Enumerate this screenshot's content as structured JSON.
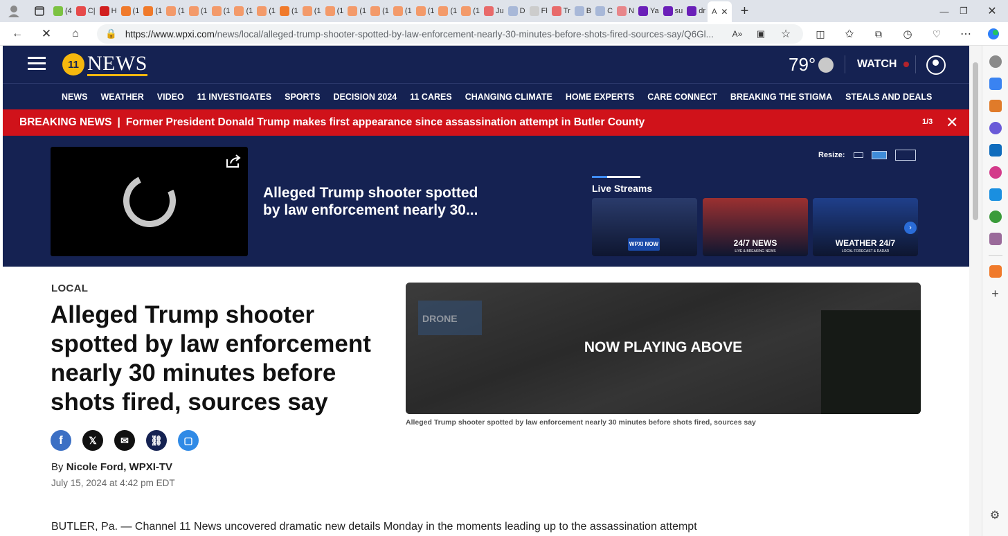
{
  "browser": {
    "tabs": [
      {
        "label": "(4",
        "color": "#7cc242"
      },
      {
        "label": "C|",
        "color": "#e64a4a"
      },
      {
        "label": "H",
        "color": "#d11f1f"
      },
      {
        "label": "(1",
        "color": "#f07a2b"
      },
      {
        "label": "(1",
        "color": "#f07a2b"
      },
      {
        "label": "(1",
        "color": "#f39a6a"
      },
      {
        "label": "(1",
        "color": "#f39a6a"
      },
      {
        "label": "(1",
        "color": "#f39a6a"
      },
      {
        "label": "(1",
        "color": "#f39a6a"
      },
      {
        "label": "(1",
        "color": "#f39a6a"
      },
      {
        "label": "(1",
        "color": "#f07a2b"
      },
      {
        "label": "(1",
        "color": "#f39a6a"
      },
      {
        "label": "(1",
        "color": "#f39a6a"
      },
      {
        "label": "(1",
        "color": "#f39a6a"
      },
      {
        "label": "(1",
        "color": "#f39a6a"
      },
      {
        "label": "(1",
        "color": "#f39a6a"
      },
      {
        "label": "(1",
        "color": "#f39a6a"
      },
      {
        "label": "(1",
        "color": "#f39a6a"
      },
      {
        "label": "(1",
        "color": "#f39a6a"
      },
      {
        "label": "Ju",
        "color": "#e86a6a"
      },
      {
        "label": "D",
        "color": "#a8b8d8"
      },
      {
        "label": "Fl",
        "color": "#cccccc"
      },
      {
        "label": "Tr",
        "color": "#e86a6a"
      },
      {
        "label": "B",
        "color": "#a8b8d8"
      },
      {
        "label": "C",
        "color": "#a8b8d8"
      },
      {
        "label": "N",
        "color": "#e8868a"
      },
      {
        "label": "Ya",
        "color": "#6a1fb8"
      },
      {
        "label": "su",
        "color": "#6a1fb8"
      },
      {
        "label": "dr",
        "color": "#6a1fb8"
      }
    ],
    "active_tab": {
      "label": "A",
      "close": "✕"
    },
    "new_tab": "+",
    "url_host": "https://www.wpxi.com",
    "url_path": "/news/local/alleged-trump-shooter-spotted-by-law-enforcement-nearly-30-minutes-before-shots-fired-sources-say/Q6Gl..."
  },
  "site": {
    "logo_number": "11",
    "logo_text": "NEWS",
    "temperature": "79°",
    "watch_label": "WATCH",
    "nav": [
      "NEWS",
      "WEATHER",
      "VIDEO",
      "11 INVESTIGATES",
      "SPORTS",
      "DECISION 2024",
      "11 CARES",
      "CHANGING CLIMATE",
      "HOME EXPERTS",
      "CARE CONNECT",
      "BREAKING THE STIGMA",
      "STEALS AND DEALS"
    ],
    "breaking": {
      "label": "BREAKING NEWS",
      "separator": "|",
      "text": "Former President Donald Trump makes first appearance since assassination attempt in Butler County",
      "count": "1/3",
      "close": "✕"
    }
  },
  "hero": {
    "title": "Alleged Trump shooter spotted by law enforcement nearly 30...",
    "resize_label": "Resize:",
    "live_streams_label": "Live Streams",
    "streams": [
      {
        "label": "",
        "badge": "WPXI NOW",
        "bg": "#2a3b6b"
      },
      {
        "label": "24/7 NEWS",
        "sub": "LIVE & BREAKING NEWS",
        "bg": "#9b3030"
      },
      {
        "label": "WEATHER 24/7",
        "sub": "LOCAL FORECAST & RADAR",
        "bg": "#1f3f8a"
      }
    ]
  },
  "article": {
    "section": "LOCAL",
    "headline": "Alleged Trump shooter spotted by law enforcement nearly 30 minutes before shots fired, sources say",
    "byline_prefix": "By",
    "author": "Nicole Ford, WPXI-TV",
    "date": "July 15, 2024 at 4:42 pm EDT",
    "media_overlay": "NOW PLAYING ABOVE",
    "drone_label": "DRONE",
    "caption": "Alleged Trump shooter spotted by law enforcement nearly 30 minutes before shots fired, sources say",
    "body_first_line": "BUTLER, Pa. — Channel 11 News uncovered dramatic new details Monday in the moments leading up to the assassination attempt"
  }
}
